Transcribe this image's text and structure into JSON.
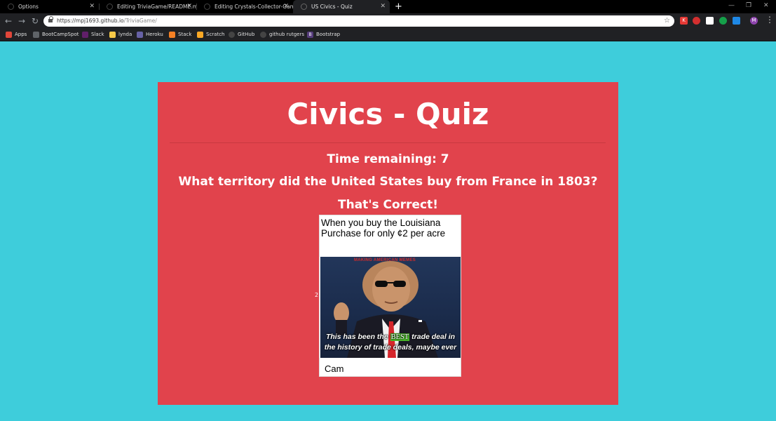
{
  "browser": {
    "tabs": [
      {
        "title": "Options",
        "active": false
      },
      {
        "title": "Editing TriviaGame/README.md",
        "active": false
      },
      {
        "title": "Editing Crystals-Collector-Game/",
        "active": false
      },
      {
        "title": "US Civics - Quiz",
        "active": true
      }
    ],
    "new_tab": "+",
    "url_host": "https://mpj1693.github.io",
    "url_path": "/TriviaGame/",
    "extensions": [
      "K",
      "",
      "",
      "",
      "",
      "M"
    ],
    "bookmarks": [
      {
        "label": "Apps",
        "color": "#e0463a",
        "icon": "apps-icon"
      },
      {
        "label": "BootCampSpot",
        "color": "#5f6368",
        "icon": "page-icon"
      },
      {
        "label": "Slack",
        "color": "#611f69",
        "icon": "slack-icon"
      },
      {
        "label": "lynda",
        "color": "#f7c948",
        "icon": "lynda-icon"
      },
      {
        "label": "Heroku",
        "color": "#6762a6",
        "icon": "heroku-icon"
      },
      {
        "label": "Stack",
        "color": "#f48024",
        "icon": "stackoverflow-icon"
      },
      {
        "label": "Scratch",
        "color": "#f9a825",
        "icon": "scratch-icon"
      },
      {
        "label": "GitHub",
        "color": "#444",
        "icon": "github-icon"
      },
      {
        "label": "github rutgers",
        "color": "#444",
        "icon": "github-icon"
      },
      {
        "label": "Bootstrap",
        "color": "#563d7c",
        "icon": "bootstrap-icon"
      }
    ]
  },
  "quiz": {
    "title": "Civics - Quiz",
    "timer": "Time remaining: 7",
    "question": "What territory did the United States buy from France in 1803?",
    "result": "That's Correct!",
    "stray_number": "2"
  },
  "meme": {
    "caption": "When you buy the Louisiana Purchase for only ¢2 per acre",
    "watermark": "MAKING AMERICAN MEMES",
    "sub_before": "This has been the ",
    "sub_highlight": "BEST",
    "sub_after": " trade deal in the history of trade deals, maybe ever",
    "credit": "Cam"
  },
  "colors": {
    "page_bg": "#3ecddb",
    "card_bg": "#e1434c"
  }
}
